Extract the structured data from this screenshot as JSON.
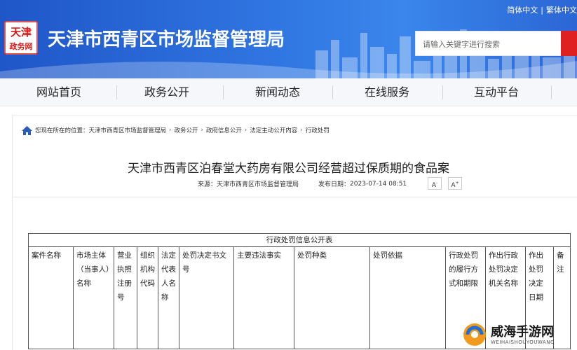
{
  "header": {
    "site_title": "天津市西青区市场监督管理局",
    "lang_simplified": "简体中文",
    "lang_traditional": "繁体中文",
    "search_placeholder": "请输入关键字进行搜索",
    "logo_text": "天津\n政务网"
  },
  "nav": {
    "items": [
      {
        "label": "网站首页"
      },
      {
        "label": "政务公开"
      },
      {
        "label": "新闻动态"
      },
      {
        "label": "在线服务"
      },
      {
        "label": "互动平台"
      }
    ]
  },
  "breadcrumb": {
    "prefix": "您现在所在的位置：",
    "items": [
      "天津市西青区市场监督管理局",
      "政务公开",
      "政府信息公开",
      "法定主动公开内容",
      "行政处罚"
    ]
  },
  "article": {
    "title": "天津市西青区泊春堂大药房有限公司经营超过保质期的食品案",
    "source_label": "来源：",
    "source": "天津市西青区市场监督管理局",
    "date_label": "发布日期：",
    "date": "2023-07-14 08:51",
    "font_decrease": "A",
    "font_increase": "A"
  },
  "table": {
    "caption": "行政处罚信息公开表",
    "headers": [
      "案件名称",
      "市场主体（当事人）名称",
      "营业执照注册号",
      "组织机构代码",
      "法定代表人名称",
      "处罚决定书文号",
      "主要违法事实",
      "处罚种类",
      "处罚依据",
      "行政处罚的履行方式和期限",
      "作出行政处罚决定机关名称",
      "作出处罚决定日期",
      "备注"
    ]
  },
  "watermark": {
    "main": "威海手游网",
    "sub": "WEIHAISHOUYOUWANG"
  },
  "colors": {
    "banner_blue": "#2f74e0",
    "search_button_red": "#e02020",
    "nav_background": "#f5f7fa"
  }
}
